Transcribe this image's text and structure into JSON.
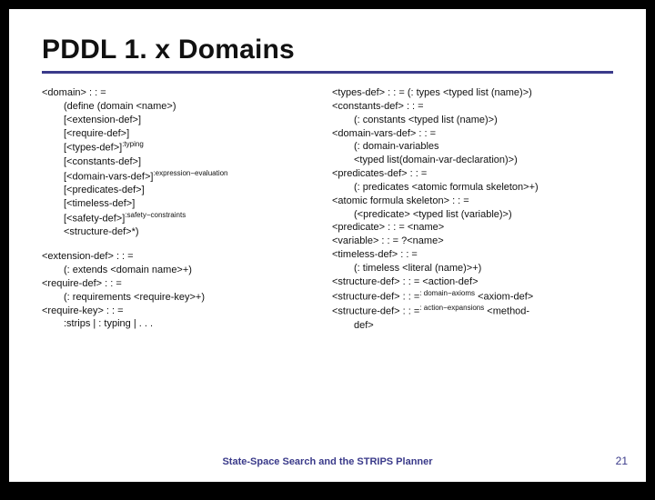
{
  "title": "PDDL 1. x Domains",
  "left": {
    "domain_head": "<domain> : : =",
    "domain_indent": [
      "(define (domain <name>)",
      "[<extension-def>]",
      "[<require-def>]",
      {
        "text": "[<types-def>]",
        "sup": ":typing"
      },
      "[<constants-def>]",
      {
        "text": "[<domain-vars-def>]",
        "sup": ":expression−evaluation"
      },
      "[<predicates-def>]",
      "[<timeless-def>]",
      {
        "text": "[<safety-def>]",
        "sup": ":safety−constraints"
      },
      "<structure-def>*)"
    ],
    "block2": [
      "<extension-def> : : =",
      {
        "indent": "(: extends <domain name>+)"
      },
      "<require-def> : : =",
      {
        "indent": "(: requirements <require-key>+)"
      },
      "<require-key> : : =",
      {
        "indent": ":strips | : typing | . . ."
      }
    ]
  },
  "right": [
    "<types-def> : : = (: types <typed list (name)>)",
    "<constants-def> : : =",
    {
      "indent": "(: constants <typed list (name)>)"
    },
    "<domain-vars-def> : : =",
    {
      "indent": "(: domain-variables"
    },
    {
      "indent": "<typed list(domain-var-declaration)>)"
    },
    "<predicates-def> : : =",
    {
      "indent": "(: predicates <atomic formula skeleton>+)"
    },
    "<atomic formula skeleton> : : =",
    {
      "indent": "(<predicate> <typed list (variable)>)"
    },
    "<predicate> : : = <name>",
    "<variable> : : = ?<name>",
    "<timeless-def> : : =",
    {
      "indent": "(: timeless <literal (name)>+)"
    },
    "<structure-def> : : = <action-def>",
    {
      "line": "<structure-def> : : =",
      "sup": ": domain−axioms",
      "tail": " <axiom-def>"
    },
    {
      "line": "<structure-def> : : =",
      "sup": ": action−expansions",
      "tail": " <method-"
    },
    {
      "indent": "def>"
    }
  ],
  "footer": "State-Space Search and the STRIPS Planner",
  "page": "21"
}
